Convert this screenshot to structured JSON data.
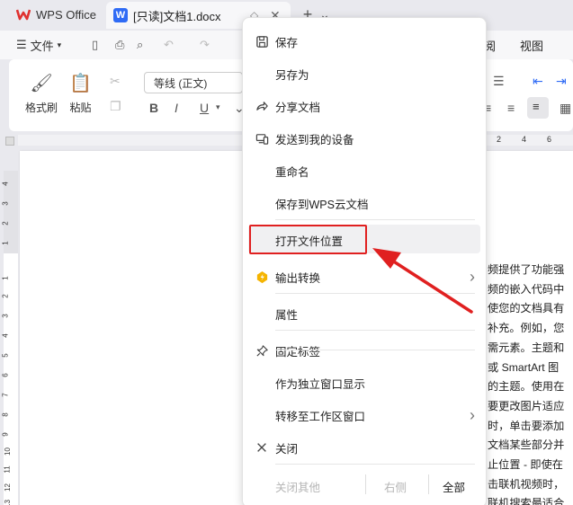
{
  "tabbar": {
    "app_label": "WPS Office",
    "doc_tab_label": "[只读]文档1.docx",
    "new_tab_symbol": "+",
    "dropdown_symbol": "⌄"
  },
  "menurow": {
    "file_label": "文件",
    "view_label": "视图",
    "partial_label": "阅"
  },
  "ribbon": {
    "format_painter_label": "格式刷",
    "paste_label": "粘贴",
    "font_name": "等线 (正文)"
  },
  "ruler": {
    "h_numbers": [
      "2",
      "4",
      "6"
    ],
    "v_numbers": [
      "4",
      "3",
      "2",
      "1",
      "1",
      "2",
      "3",
      "4",
      "5",
      "6",
      "7",
      "8",
      "9",
      "10",
      "11",
      "12",
      "13"
    ]
  },
  "context_menu": {
    "items": [
      {
        "label": "保存",
        "icon": "save-icon"
      },
      {
        "label": "另存为",
        "icon": ""
      },
      {
        "label": "分享文档",
        "icon": "share-icon"
      },
      {
        "label": "发送到我的设备",
        "icon": "device-icon"
      },
      {
        "label": "重命名",
        "icon": ""
      },
      {
        "label": "保存到WPS云文档",
        "icon": ""
      },
      {
        "label": "打开文件位置",
        "icon": ""
      },
      {
        "label": "输出转换",
        "icon": "convert-icon"
      },
      {
        "label": "属性",
        "icon": ""
      },
      {
        "label": "固定标签",
        "icon": "pin-icon"
      },
      {
        "label": "作为独立窗口显示",
        "icon": ""
      },
      {
        "label": "转移至工作区窗口",
        "icon": ""
      },
      {
        "label": "关闭",
        "icon": "close-icon"
      }
    ],
    "bottom": {
      "close_others": "关闭其他",
      "right_side": "右侧",
      "all": "全部"
    }
  },
  "document": {
    "lines": [
      "频提供了功能强",
      "频的嵌入代码中",
      "使您的文档具有",
      "补充。例如，您",
      "需元素。主题和",
      "或 SmartArt 图",
      "的主题。使用在",
      "要更改图片适应",
      "时，单击要添加",
      "文档某些部分并",
      "止位置 - 即使在",
      "击联机视频时，",
      "联机搜索最适合"
    ]
  },
  "colors": {
    "highlight_box": "#e02020",
    "wps_red": "#e0312f",
    "word_blue": "#2f6bf5"
  }
}
